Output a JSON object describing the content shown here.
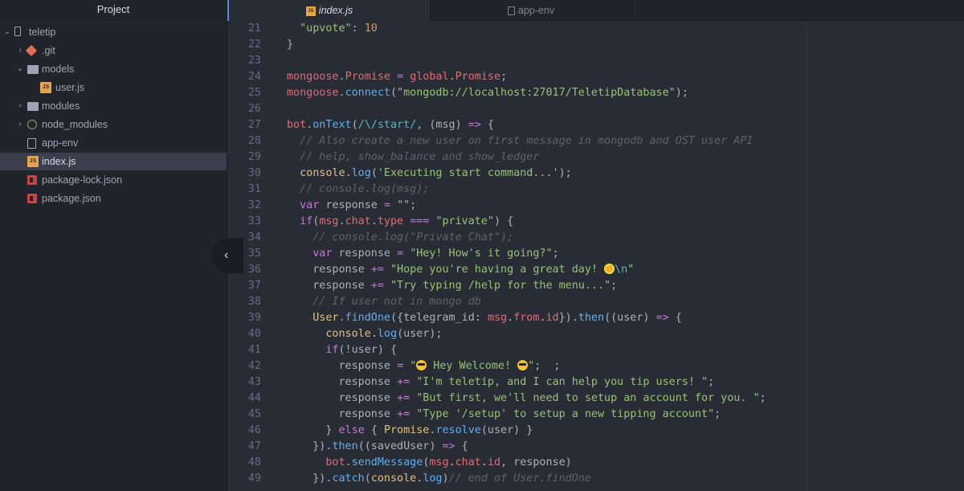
{
  "sidebar": {
    "title": "Project",
    "collapse_icon": "‹",
    "items": [
      {
        "label": "teletip",
        "icon": "repo-icon",
        "chevron": "⌄"
      },
      {
        "label": ".git",
        "icon": "git-icon",
        "chevron": "›"
      },
      {
        "label": "models",
        "icon": "folder-icon",
        "chevron": "⌄"
      },
      {
        "label": "user.js",
        "icon": "js-file-icon",
        "chevron": ""
      },
      {
        "label": "modules",
        "icon": "folder-icon",
        "chevron": "›"
      },
      {
        "label": "node_modules",
        "icon": "node-icon",
        "chevron": "›"
      },
      {
        "label": "app-env",
        "icon": "file-icon",
        "chevron": ""
      },
      {
        "label": "index.js",
        "icon": "js-file-icon",
        "chevron": "",
        "selected": true
      },
      {
        "label": "package-lock.json",
        "icon": "npm-icon",
        "chevron": ""
      },
      {
        "label": "package.json",
        "icon": "npm-icon",
        "chevron": ""
      }
    ]
  },
  "tabs": [
    {
      "label": "index.js",
      "icon": "js-file-icon",
      "active": true,
      "icon_text": "JS"
    },
    {
      "label": "app-env",
      "icon": "file-icon",
      "active": false
    }
  ],
  "colors": {
    "background": "#282c34",
    "sidebar": "#21252b",
    "accent": "#568af2"
  },
  "code": {
    "lines": [
      {
        "num": "21",
        "segs": [
          {
            "t": "  "
          },
          {
            "t": "\"upvote\"",
            "c": "s"
          },
          {
            "t": ": "
          },
          {
            "t": "10",
            "c": "n"
          }
        ]
      },
      {
        "num": "22",
        "segs": [
          {
            "t": "}"
          }
        ]
      },
      {
        "num": "23",
        "segs": []
      },
      {
        "num": "24",
        "segs": [
          {
            "t": "mongoose",
            "c": "v"
          },
          {
            "t": "."
          },
          {
            "t": "Promise",
            "c": "v"
          },
          {
            "t": " "
          },
          {
            "t": "=",
            "c": "o"
          },
          {
            "t": " "
          },
          {
            "t": "global",
            "c": "v"
          },
          {
            "t": "."
          },
          {
            "t": "Promise",
            "c": "v"
          },
          {
            "t": ";"
          }
        ]
      },
      {
        "num": "25",
        "segs": [
          {
            "t": "mongoose",
            "c": "v"
          },
          {
            "t": "."
          },
          {
            "t": "connect",
            "c": "f"
          },
          {
            "t": "("
          },
          {
            "t": "\"mongodb://localhost:27017/TeletipDatabase\"",
            "c": "s"
          },
          {
            "t": ");"
          }
        ]
      },
      {
        "num": "26",
        "segs": []
      },
      {
        "num": "27",
        "segs": [
          {
            "t": "bot",
            "c": "v"
          },
          {
            "t": "."
          },
          {
            "t": "onText",
            "c": "f"
          },
          {
            "t": "("
          },
          {
            "t": "/\\/start/",
            "c": "e"
          },
          {
            "t": ", (msg) "
          },
          {
            "t": "=>",
            "c": "o"
          },
          {
            "t": " {"
          }
        ]
      },
      {
        "num": "28",
        "segs": [
          {
            "t": "  "
          },
          {
            "t": "// Also create a new user on first message in mongodb and OST user API",
            "c": "c"
          }
        ]
      },
      {
        "num": "29",
        "segs": [
          {
            "t": "  "
          },
          {
            "t": "// help, show_balance and show_ledger",
            "c": "c"
          }
        ]
      },
      {
        "num": "30",
        "segs": [
          {
            "t": "  "
          },
          {
            "t": "console",
            "c": "y"
          },
          {
            "t": "."
          },
          {
            "t": "log",
            "c": "f"
          },
          {
            "t": "("
          },
          {
            "t": "'Executing start command...'",
            "c": "s"
          },
          {
            "t": ");"
          }
        ]
      },
      {
        "num": "31",
        "segs": [
          {
            "t": "  "
          },
          {
            "t": "// console.log(msg);",
            "c": "c"
          }
        ]
      },
      {
        "num": "32",
        "segs": [
          {
            "t": "  "
          },
          {
            "t": "var",
            "c": "k"
          },
          {
            "t": " response "
          },
          {
            "t": "=",
            "c": "o"
          },
          {
            "t": " "
          },
          {
            "t": "\"\"",
            "c": "s"
          },
          {
            "t": ";"
          }
        ]
      },
      {
        "num": "33",
        "segs": [
          {
            "t": "  "
          },
          {
            "t": "if",
            "c": "k"
          },
          {
            "t": "("
          },
          {
            "t": "msg",
            "c": "v"
          },
          {
            "t": "."
          },
          {
            "t": "chat",
            "c": "v"
          },
          {
            "t": "."
          },
          {
            "t": "type",
            "c": "v"
          },
          {
            "t": " "
          },
          {
            "t": "===",
            "c": "o"
          },
          {
            "t": " "
          },
          {
            "t": "\"private\"",
            "c": "s"
          },
          {
            "t": ") {"
          }
        ]
      },
      {
        "num": "34",
        "segs": [
          {
            "t": "    "
          },
          {
            "t": "// console.log(\"Private Chat\");",
            "c": "c"
          }
        ]
      },
      {
        "num": "35",
        "segs": [
          {
            "t": "    "
          },
          {
            "t": "var",
            "c": "k"
          },
          {
            "t": " response "
          },
          {
            "t": "=",
            "c": "o"
          },
          {
            "t": " "
          },
          {
            "t": "\"Hey! How's it going?\"",
            "c": "s"
          },
          {
            "t": ";"
          }
        ]
      },
      {
        "num": "36",
        "segs": [
          {
            "t": "    response "
          },
          {
            "t": "+=",
            "c": "o"
          },
          {
            "t": " "
          },
          {
            "t": "\"Hope you're having a great day! ",
            "c": "s"
          },
          {
            "emoji": "flower"
          },
          {
            "t": "\\n",
            "c": "e"
          },
          {
            "t": "\"",
            "c": "s"
          }
        ]
      },
      {
        "num": "37",
        "segs": [
          {
            "t": "    response "
          },
          {
            "t": "+=",
            "c": "o"
          },
          {
            "t": " "
          },
          {
            "t": "\"Try typing /help for the menu...\"",
            "c": "s"
          },
          {
            "t": ";"
          }
        ]
      },
      {
        "num": "38",
        "segs": [
          {
            "t": "    "
          },
          {
            "t": "// If user not in mongo db",
            "c": "c"
          }
        ]
      },
      {
        "num": "39",
        "segs": [
          {
            "t": "    "
          },
          {
            "t": "User",
            "c": "y"
          },
          {
            "t": "."
          },
          {
            "t": "findOne",
            "c": "f"
          },
          {
            "t": "({telegram_id: "
          },
          {
            "t": "msg",
            "c": "v"
          },
          {
            "t": "."
          },
          {
            "t": "from",
            "c": "v"
          },
          {
            "t": "."
          },
          {
            "t": "id",
            "c": "v"
          },
          {
            "t": "})."
          },
          {
            "t": "then",
            "c": "f"
          },
          {
            "t": "((user) "
          },
          {
            "t": "=>",
            "c": "o"
          },
          {
            "t": " {"
          }
        ]
      },
      {
        "num": "40",
        "segs": [
          {
            "t": "      "
          },
          {
            "t": "console",
            "c": "y"
          },
          {
            "t": "."
          },
          {
            "t": "log",
            "c": "f"
          },
          {
            "t": "(user);"
          }
        ]
      },
      {
        "num": "41",
        "segs": [
          {
            "t": "      "
          },
          {
            "t": "if",
            "c": "k"
          },
          {
            "t": "(!user) {"
          }
        ]
      },
      {
        "num": "42",
        "segs": [
          {
            "t": "        response "
          },
          {
            "t": "=",
            "c": "o"
          },
          {
            "t": " "
          },
          {
            "t": "\"",
            "c": "s"
          },
          {
            "emoji": "cool"
          },
          {
            "t": " Hey Welcome! ",
            "c": "s"
          },
          {
            "emoji": "cool"
          },
          {
            "t": "\"",
            "c": "s"
          },
          {
            "t": ";  ;"
          }
        ]
      },
      {
        "num": "43",
        "segs": [
          {
            "t": "        response "
          },
          {
            "t": "+=",
            "c": "o"
          },
          {
            "t": " "
          },
          {
            "t": "\"I'm teletip, and I can help you tip users! \"",
            "c": "s"
          },
          {
            "t": ";"
          }
        ]
      },
      {
        "num": "44",
        "segs": [
          {
            "t": "        response "
          },
          {
            "t": "+=",
            "c": "o"
          },
          {
            "t": " "
          },
          {
            "t": "\"But first, we'll need to setup an account for you. \"",
            "c": "s"
          },
          {
            "t": ";"
          }
        ]
      },
      {
        "num": "45",
        "segs": [
          {
            "t": "        response "
          },
          {
            "t": "+=",
            "c": "o"
          },
          {
            "t": " "
          },
          {
            "t": "\"Type '/setup' to setup a new tipping account\"",
            "c": "s"
          },
          {
            "t": ";"
          }
        ]
      },
      {
        "num": "46",
        "segs": [
          {
            "t": "      } "
          },
          {
            "t": "else",
            "c": "k"
          },
          {
            "t": " { "
          },
          {
            "t": "Promise",
            "c": "y"
          },
          {
            "t": "."
          },
          {
            "t": "resolve",
            "c": "f"
          },
          {
            "t": "(user) }"
          }
        ]
      },
      {
        "num": "47",
        "segs": [
          {
            "t": "    })."
          },
          {
            "t": "then",
            "c": "f"
          },
          {
            "t": "((savedUser) "
          },
          {
            "t": "=>",
            "c": "o"
          },
          {
            "t": " {"
          }
        ]
      },
      {
        "num": "48",
        "segs": [
          {
            "t": "      "
          },
          {
            "t": "bot",
            "c": "v"
          },
          {
            "t": "."
          },
          {
            "t": "sendMessage",
            "c": "f"
          },
          {
            "t": "("
          },
          {
            "t": "msg",
            "c": "v"
          },
          {
            "t": "."
          },
          {
            "t": "chat",
            "c": "v"
          },
          {
            "t": "."
          },
          {
            "t": "id",
            "c": "v"
          },
          {
            "t": ", response)"
          }
        ]
      },
      {
        "num": "49",
        "segs": [
          {
            "t": "    })."
          },
          {
            "t": "catch",
            "c": "f"
          },
          {
            "t": "("
          },
          {
            "t": "console",
            "c": "y"
          },
          {
            "t": "."
          },
          {
            "t": "log",
            "c": "f"
          },
          {
            "t": ")"
          },
          {
            "t": "// end of User.findOne",
            "c": "c"
          }
        ]
      }
    ]
  }
}
